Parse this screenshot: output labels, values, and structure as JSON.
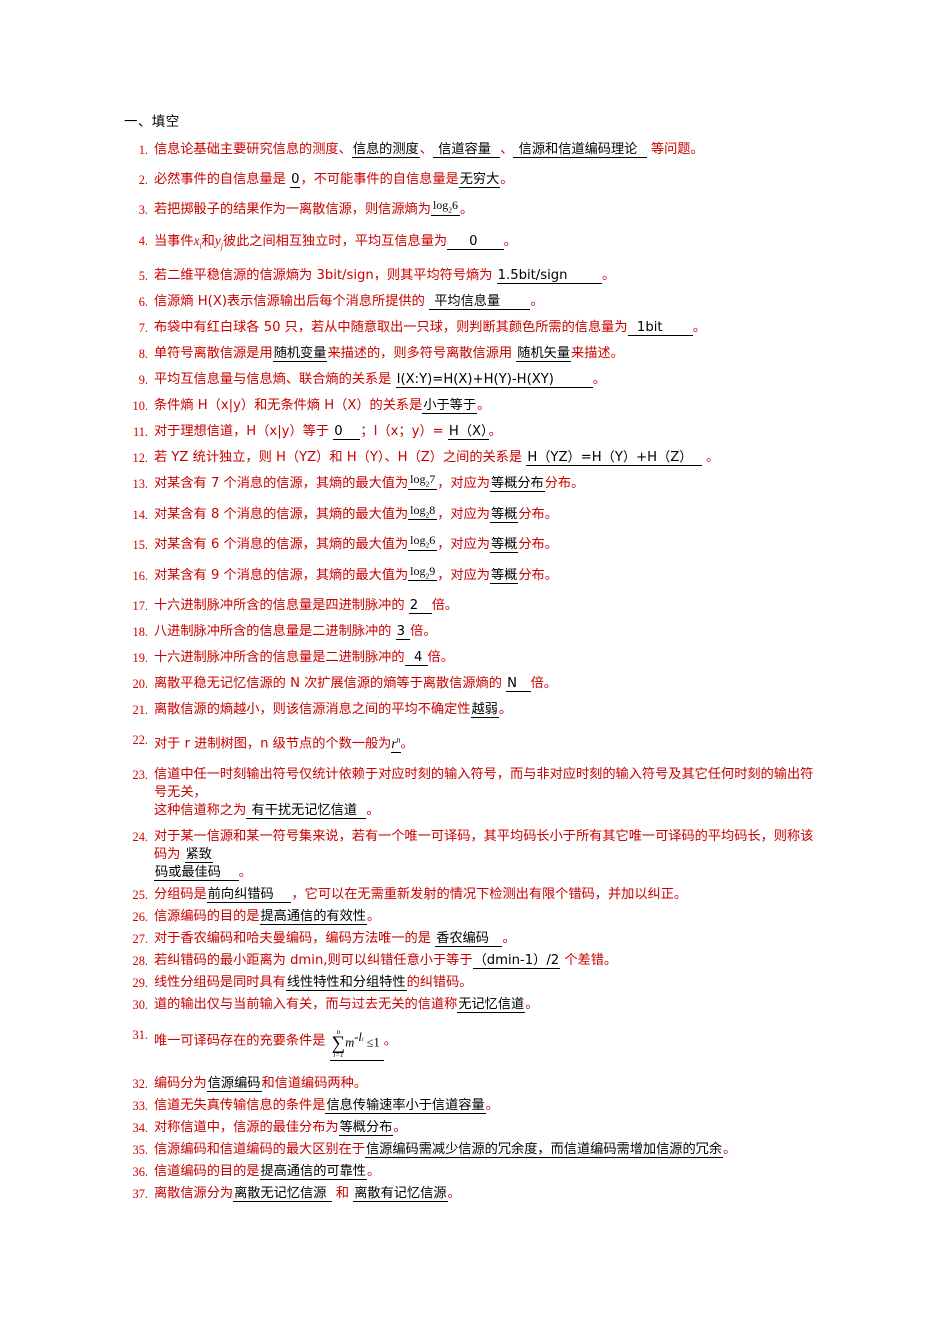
{
  "document": {
    "section_heading": "一、填空",
    "colors": {
      "question_red": "#cc0000",
      "answer_black": "#000000",
      "page_background": "#ffffff"
    }
  },
  "questions": [
    {
      "number": "1.",
      "pre": "信息论基础主要研究信息的测度、",
      "ans1": " 信道容量  ",
      "mid1": "、",
      "ans2": " 信源和信道编码理论  ",
      "post": " 等问题。",
      "answer_inline": "信息的测度"
    },
    {
      "number": "2.",
      "pre": "必然事件的自信息量是 ",
      "ans1": "0",
      "mid1": "，不可能事件的自信息量是",
      "ans2": "无穷大",
      "post": "。"
    },
    {
      "number": "3.",
      "pre": "若把掷骰子的结果作为一离散信源，则信源熵为",
      "formula": "log",
      "formula_sub": "2",
      "formula_arg": "6",
      "post": "。"
    },
    {
      "number": "4.",
      "pre": "当事件",
      "var1": "x",
      "var1_sub": "i",
      "mid1": "和",
      "var2": "y",
      "var2_sub": "j",
      "mid2": "彼此之间相互独立时，平均互信息量为",
      "ans1": "     0      ",
      "post": "。"
    },
    {
      "number": "5.",
      "pre": "若二维平稳信源的信源熵为 3bit/sign，则其平均符号熵为 ",
      "ans1": "1.5bit/sign        ",
      "post": "。"
    },
    {
      "number": "6.",
      "pre": "信源熵 H(X)表示信源输出后每个消息所提供的 ",
      "ans1": " 平均信息量       ",
      "post": "。"
    },
    {
      "number": "7.",
      "pre": "布袋中有红白球各 50 只，若从中随意取出一只球，则判断其颜色所需的信息量为",
      "ans1": "  1bit       ",
      "post": "。"
    },
    {
      "number": "8.",
      "pre": "单符号离散信源是用",
      "ans1": "随机变量",
      "mid1": "来描述的，则多符号离散信源用 ",
      "ans2": "随机矢量",
      "post": "来描述。"
    },
    {
      "number": "9.",
      "pre": "平均互信息量与信息熵、联合熵的关系是 ",
      "ans1": "I(X:Y)=H(X)+H(Y)-H(XY)         ",
      "post": "。"
    },
    {
      "number": "10.",
      "pre": "条件熵 H（x|y）和无条件熵 H（X）的关系是",
      "ans1": "小于等于",
      "post": "。"
    },
    {
      "number": "11.",
      "pre": "对于理想信道，H（x|y）等于 ",
      "ans1": "0    ",
      "mid1": "；I（x；y）= ",
      "ans2": "H（X）",
      "post": "。"
    },
    {
      "number": "12.",
      "pre": "若 YZ 统计独立，则 H（YZ）和 H（Y）、H（Z）之间的关系是 ",
      "ans1": "H（YZ）=H（Y）+H（Z）  ",
      "post": " 。"
    },
    {
      "number": "13.",
      "pre": "对某含有 7 个消息的信源，其熵的最大值为",
      "formula": "log",
      "formula_sub": "2",
      "formula_arg": "7",
      "mid1": "，对应为",
      "ans1": "等概分布",
      "post": "分布。"
    },
    {
      "number": "14.",
      "pre": "对某含有 8 个消息的信源，其熵的最大值为",
      "formula": "log",
      "formula_sub": "2",
      "formula_arg": "8",
      "mid1": "，对应为",
      "ans1": "等概",
      "post": "分布。"
    },
    {
      "number": "15.",
      "pre": "对某含有 6 个消息的信源，其熵的最大值为",
      "formula": "log",
      "formula_sub": "2",
      "formula_arg": "6",
      "mid1": "，对应为",
      "ans1": "等概",
      "post": "分布。"
    },
    {
      "number": "16.",
      "pre": "对某含有 9 个消息的信源，其熵的最大值为",
      "formula": "log",
      "formula_sub": "2",
      "formula_arg": "9",
      "mid1": "，对应为",
      "ans1": "等概",
      "post": "分布。"
    },
    {
      "number": "17.",
      "pre": "十六进制脉冲所含的信息量是四进制脉冲的 ",
      "ans1": "2   ",
      "post": "倍。"
    },
    {
      "number": "18.",
      "pre": "八进制脉冲所含的信息量是二进制脉冲的 ",
      "ans1": "3 ",
      "post": "倍。"
    },
    {
      "number": "19.",
      "pre": "十六进制脉冲所含的信息量是二进制脉冲的",
      "ans1": "  4 ",
      "post": "倍。"
    },
    {
      "number": "20.",
      "pre": "离散平稳无记忆信源的 N 次扩展信源的熵等于离散信源熵的 ",
      "ans1": "N   ",
      "post": "倍。"
    },
    {
      "number": "21.",
      "pre": "离散信源的熵越小，则该信源消息之间的平均不确定性",
      "ans1": "越弱",
      "post": "。"
    },
    {
      "number": "22.",
      "pre": "对于 r 进制树图，n 级节点的个数一般为",
      "ans_var": "r",
      "ans_sup": "n",
      "post": "。"
    },
    {
      "number": "23.",
      "pre": "信道中任一时刻输出符号仅统计依赖于对应时刻的输入符号，而与非对应时刻的输入符号及其它任何时刻的输出符号无关，",
      "line2_pre": "这种信道称之为",
      "ans1": " 有干扰无记忆信道  ",
      "post": "。"
    },
    {
      "number": "24.",
      "pre": "对于某一信源和某一符号集来说，若有一个唯一可译码，其平均码长小于所有其它唯一可译码的平均码长，则称该码为 ",
      "ans1": "紧致",
      "line2_ans": "码或最佳码    ",
      "post": "。"
    },
    {
      "number": "25.",
      "pre": "分组码是",
      "ans1": "前向纠错码    ",
      "post": "，它可以在无需重新发射的情况下检测出有限个错码，并加以纠正。"
    },
    {
      "number": "26.",
      "pre": "信源编码的目的是",
      "ans1": "提高通信的有效性",
      "post": "。"
    },
    {
      "number": "27.",
      "pre": "对于香农编码和哈夫曼编码，编码方法唯一的是 ",
      "ans1": "香农编码   ",
      "post": "。"
    },
    {
      "number": "28.",
      "pre": "若纠错码的最小距离为 dmin,则可以纠错任意小于等于",
      "ans1": "（dmin-1）/2",
      "post": " 个差错。"
    },
    {
      "number": "29.",
      "pre": "线性分组码是同时具有",
      "ans1": "线性特性和分组特性",
      "post": "的纠错码。"
    },
    {
      "number": "30.",
      "pre": "道的输出仅与当前输入有关，而与过去无关的信道称",
      "ans1": "无记忆信道",
      "post": "。"
    },
    {
      "number": "31.",
      "pre": "唯一可译码存在的充要条件是 ",
      "sigma_top": "n",
      "sigma_bot": "i=1",
      "sigma_term": "m",
      "sigma_exp": "-l",
      "sigma_exp_sub": "i",
      "sigma_rel": " ≤1",
      "post": "。"
    },
    {
      "number": "32.",
      "pre": "编码分为",
      "ans1": "信源编码",
      "post": "和信道编码两种。"
    },
    {
      "number": "33.",
      "pre": "信道无失真传输信息的条件是",
      "ans1": "信息传输速率小于信道容量",
      "post": "。"
    },
    {
      "number": "34.",
      "pre": "对称信道中，信源的最佳分布为",
      "ans1": "等概分布",
      "post": "。"
    },
    {
      "number": "35.",
      "pre": "信源编码和信道编码的最大区别在于",
      "ans1": "信源编码需减少信源的冗余度，而信道编码需增加信源的冗余",
      "post": "。"
    },
    {
      "number": "36.",
      "pre": "信道编码的目的是",
      "ans1": "提高通信的可靠性",
      "post": "。"
    },
    {
      "number": "37.",
      "pre": "离散信源分为",
      "ans1": "离散无记忆信源 ",
      "mid1": " 和 ",
      "ans2": "离散有记忆信源",
      "post": "。"
    }
  ]
}
